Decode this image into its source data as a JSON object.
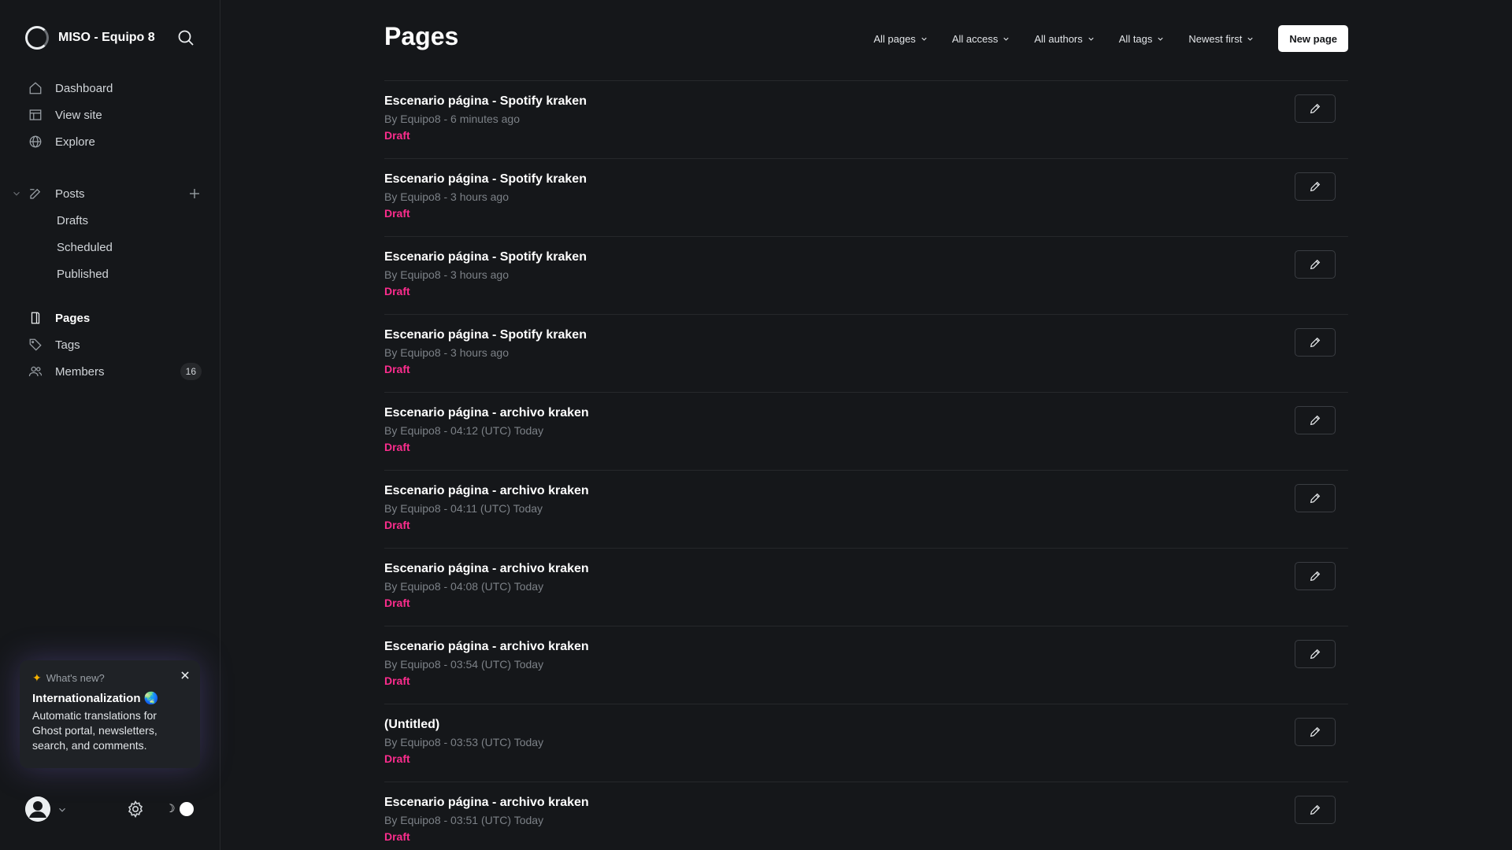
{
  "brand": {
    "name": "MISO - Equipo 8"
  },
  "nav": {
    "dashboard": "Dashboard",
    "view_site": "View site",
    "explore": "Explore",
    "posts": "Posts",
    "drafts": "Drafts",
    "scheduled": "Scheduled",
    "published": "Published",
    "pages": "Pages",
    "tags": "Tags",
    "members": "Members",
    "members_count": "16"
  },
  "whats_new": {
    "heading": "What's new?",
    "title": "Internationalization 🌏",
    "body": "Automatic translations for Ghost portal, newsletters, search, and comments."
  },
  "header": {
    "title": "Pages",
    "filters": [
      "All pages",
      "All access",
      "All authors",
      "All tags",
      "Newest first"
    ],
    "new_page": "New page"
  },
  "pages": [
    {
      "title": "Escenario página - Spotify kraken",
      "meta": "By Equipo8 - 6 minutes ago",
      "status": "Draft"
    },
    {
      "title": "Escenario página - Spotify kraken",
      "meta": "By Equipo8 - 3 hours ago",
      "status": "Draft"
    },
    {
      "title": "Escenario página - Spotify kraken",
      "meta": "By Equipo8 - 3 hours ago",
      "status": "Draft"
    },
    {
      "title": "Escenario página - Spotify kraken",
      "meta": "By Equipo8 - 3 hours ago",
      "status": "Draft"
    },
    {
      "title": "Escenario página - archivo kraken",
      "meta": "By Equipo8 - 04:12 (UTC) Today",
      "status": "Draft"
    },
    {
      "title": "Escenario página - archivo kraken",
      "meta": "By Equipo8 - 04:11 (UTC) Today",
      "status": "Draft"
    },
    {
      "title": "Escenario página - archivo kraken",
      "meta": "By Equipo8 - 04:08 (UTC) Today",
      "status": "Draft"
    },
    {
      "title": "Escenario página - archivo kraken",
      "meta": "By Equipo8 - 03:54 (UTC) Today",
      "status": "Draft"
    },
    {
      "title": "(Untitled)",
      "meta": "By Equipo8 - 03:53 (UTC) Today",
      "status": "Draft"
    },
    {
      "title": "Escenario página - archivo kraken",
      "meta": "By Equipo8 - 03:51 (UTC) Today",
      "status": "Draft"
    }
  ],
  "colors": {
    "background": "#15171a",
    "draft": "#fb2d8d",
    "text": "#ffffff",
    "muted": "#7c8187"
  },
  "icons": {
    "search": "search-icon",
    "dashboard": "home-icon",
    "view_site": "layout-icon",
    "explore": "globe-icon",
    "posts": "edit-icon",
    "pages": "page-icon",
    "tags": "tag-icon",
    "members": "members-icon",
    "settings": "gear-icon",
    "theme": "moon-icon",
    "edit": "pencil-icon"
  }
}
